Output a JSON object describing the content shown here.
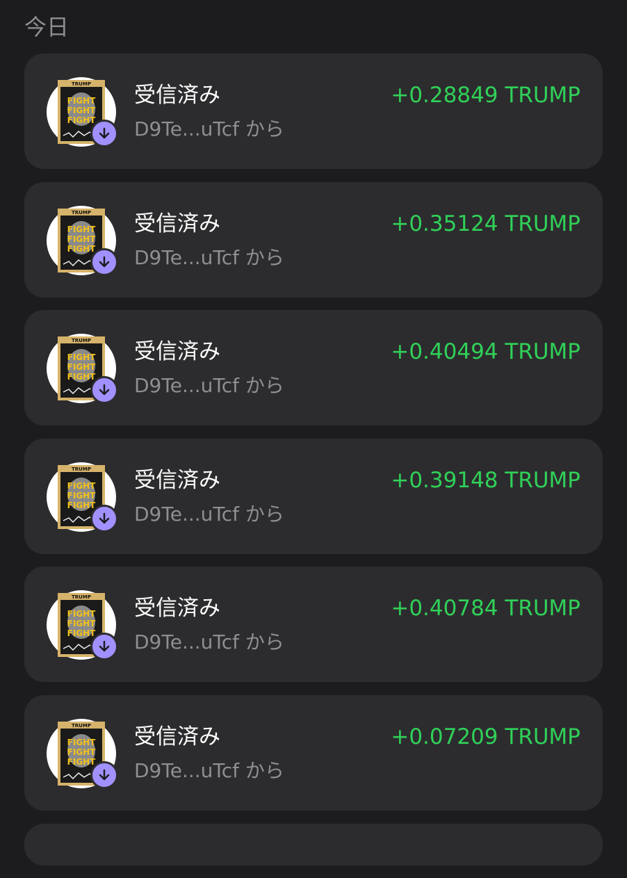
{
  "section": {
    "title": "今日"
  },
  "token": {
    "icon": "trump-token-icon",
    "poster_text": [
      "TRUMP",
      "FIGHT",
      "FIGHT",
      "FIGHT"
    ],
    "badge_icon": "arrow-down-icon"
  },
  "colors": {
    "background": "#1c1c1e",
    "card": "#2c2c2e",
    "amount_positive": "#30d158",
    "badge": "#a091ff",
    "secondary_text": "#8e8e93"
  },
  "transactions": [
    {
      "title": "受信済み",
      "from": "D9Te...uTcf から",
      "amount": "+0.28849 TRUMP"
    },
    {
      "title": "受信済み",
      "from": "D9Te...uTcf から",
      "amount": "+0.35124 TRUMP"
    },
    {
      "title": "受信済み",
      "from": "D9Te...uTcf から",
      "amount": "+0.40494 TRUMP"
    },
    {
      "title": "受信済み",
      "from": "D9Te...uTcf から",
      "amount": "+0.39148 TRUMP"
    },
    {
      "title": "受信済み",
      "from": "D9Te...uTcf から",
      "amount": "+0.40784 TRUMP"
    },
    {
      "title": "受信済み",
      "from": "D9Te...uTcf から",
      "amount": "+0.07209 TRUMP"
    }
  ]
}
